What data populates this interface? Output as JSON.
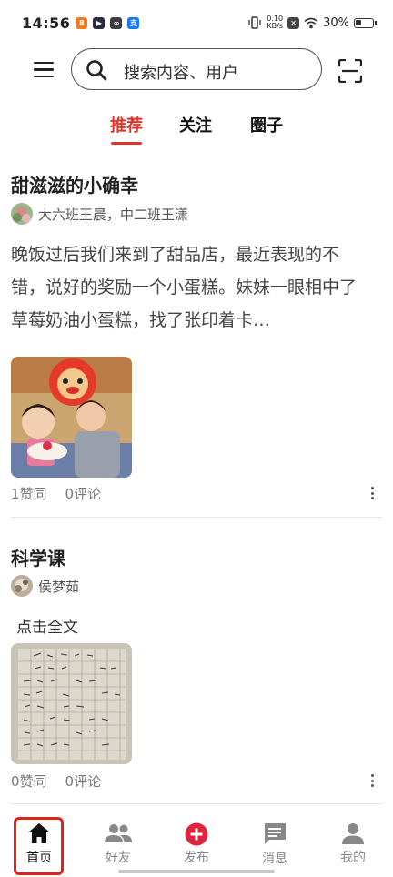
{
  "status_bar": {
    "time": "14:56",
    "net_speed_top": "0.10",
    "net_speed_unit": "KB/s",
    "battery": "30%"
  },
  "header": {
    "search_placeholder": "搜索内容、用户"
  },
  "tabs": [
    {
      "label": "推荐",
      "active": true
    },
    {
      "label": "关注",
      "active": false
    },
    {
      "label": "圈子",
      "active": false
    }
  ],
  "posts": [
    {
      "title": "甜滋滋的小确幸",
      "author": "大六班王晨，中二班王潇",
      "body": "晚饭过后我们来到了甜品店，最近表现的不错，说好的奖励一个小蛋糕。妹妹一眼相中了草莓奶油小蛋糕，找了张印着卡…",
      "likes": "1赞同",
      "comments": "0评论"
    },
    {
      "title": "科学课",
      "author": "侯梦茹",
      "read_more": "点击全文",
      "likes": "0赞同",
      "comments": "0评论"
    }
  ],
  "bottom_nav": [
    {
      "label": "首页",
      "icon": "home-icon",
      "active": true
    },
    {
      "label": "好友",
      "icon": "friends-icon",
      "active": false
    },
    {
      "label": "发布",
      "icon": "publish-plus-icon",
      "active": false
    },
    {
      "label": "消息",
      "icon": "message-icon",
      "active": false
    },
    {
      "label": "我的",
      "icon": "profile-icon",
      "active": false
    }
  ],
  "colors": {
    "accent": "#e0352b",
    "highlight_box": "#e0241b"
  }
}
